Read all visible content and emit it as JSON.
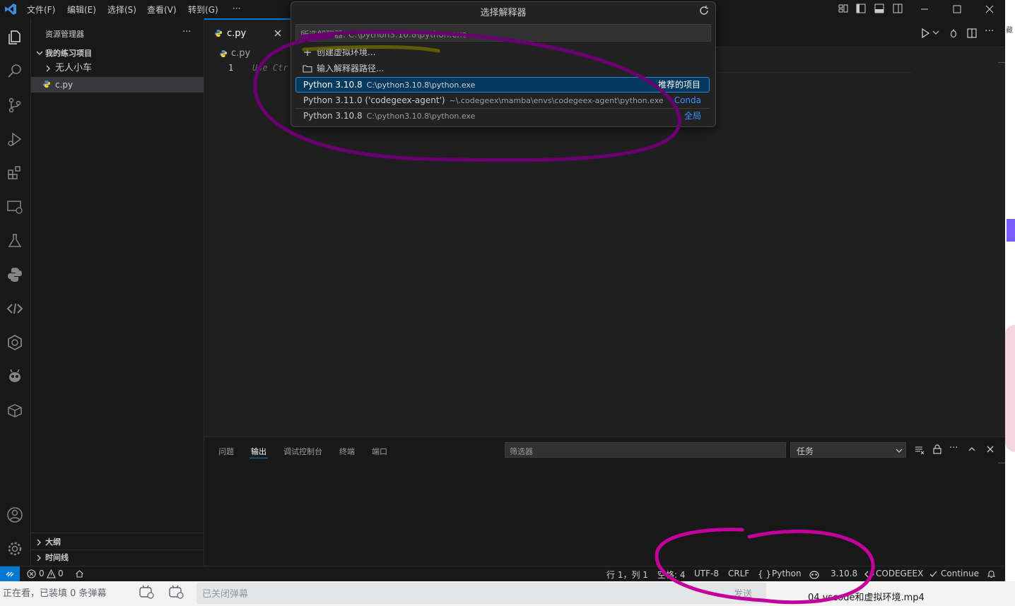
{
  "menu": {
    "file": "文件(F)",
    "edit": "编辑(E)",
    "select": "选择(S)",
    "view": "查看(V)",
    "goto": "转到(G)",
    "more": "···"
  },
  "quickpick": {
    "title": "选择解释器",
    "input_placeholder": "所选解释器: C:\\python3.10.8\\python.exe",
    "create_env": "创建虚拟环境...",
    "enter_path": "输入解释器路径...",
    "items": [
      {
        "label": "Python 3.10.8",
        "path": "C:\\python3.10.8\\python.exe",
        "tag": "推荐的项目"
      },
      {
        "label": "Python 3.11.0 ('codegeex-agent')",
        "path": "~\\.codegeex\\mamba\\envs\\codegeex-agent\\python.exe",
        "tag": "Conda"
      },
      {
        "label": "Python 3.10.8",
        "path": "C:\\python3.10.8\\python.exe",
        "tag": "全局"
      }
    ]
  },
  "sidebar": {
    "title": "资源管理器",
    "more": "···",
    "project": "我的练习项目",
    "folder": "无人小车",
    "file": "c.py",
    "outline": "大纲",
    "timeline": "时间线"
  },
  "editor": {
    "tab_label": "c.py",
    "breadcrumb": "c.py",
    "line_number": "1",
    "hint": "Use Ctr"
  },
  "panel": {
    "tabs": [
      "问题",
      "输出",
      "调试控制台",
      "终端",
      "端口"
    ],
    "active_tab": "输出",
    "filter_placeholder": "筛选器",
    "task_select": "任务"
  },
  "status": {
    "errors": "0",
    "warnings": "0",
    "position": "行 1，列 1",
    "spaces": "空格: 4",
    "encoding": "UTF-8",
    "eol": "CRLF",
    "language": "Python",
    "python_version": "3.10.8",
    "codegeex": "CODEGEEX",
    "continue": "Continue"
  },
  "bottom": {
    "danmaku_status": "正在看，已装填 0 条弹幕",
    "danmaku_closed": "已关闭弹幕",
    "send": "发送",
    "video_title": "04 vscode和虚拟环境.mp4"
  },
  "right": {
    "partial": "藏"
  },
  "colors": {
    "accent": "#0078d4",
    "selection": "#04395e",
    "link": "#3794ff",
    "annotation": "#8b0087"
  }
}
